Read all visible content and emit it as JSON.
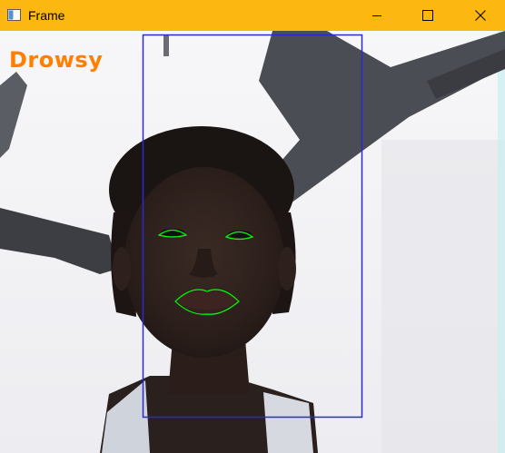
{
  "window": {
    "title": "Frame",
    "titlebar_color": "#fcb711",
    "icons": {
      "app": "window-app-icon",
      "minimize": "minimize-icon",
      "maximize": "maximize-icon",
      "close": "close-icon"
    }
  },
  "overlay": {
    "status_text": "Drowsy",
    "status_color": "#ff8000",
    "face_box_color": "#2a2ad0",
    "landmark_color": "#00ff00"
  }
}
